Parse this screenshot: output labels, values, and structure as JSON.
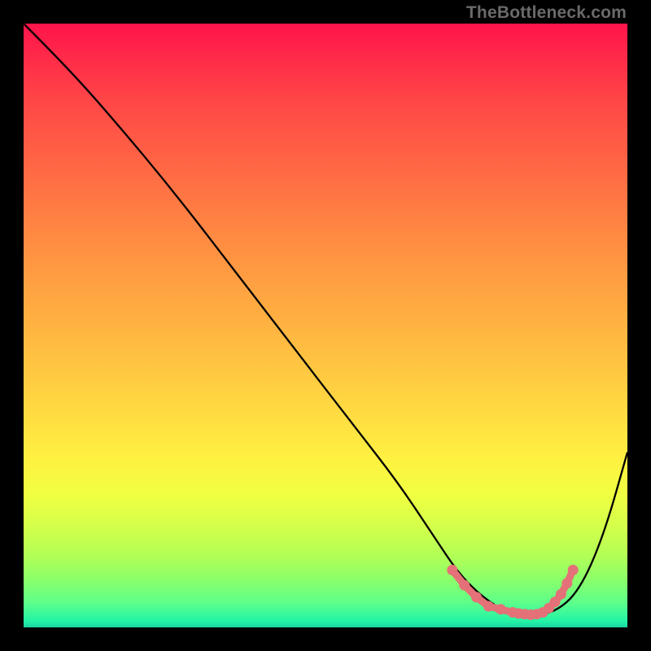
{
  "watermark": "TheBottleneck.com",
  "chart_data": {
    "type": "line",
    "title": "",
    "xlabel": "",
    "ylabel": "",
    "xlim": [
      0,
      100
    ],
    "ylim": [
      0,
      100
    ],
    "grid": false,
    "series": [
      {
        "name": "curve",
        "x": [
          0,
          7,
          15,
          25,
          35,
          45,
          55,
          62,
          68,
          72,
          76,
          80,
          84,
          88,
          92,
          96,
          100
        ],
        "y": [
          100,
          93,
          84,
          72,
          59,
          46,
          33,
          24,
          15,
          9,
          5,
          2.5,
          2,
          2.5,
          6,
          15,
          29
        ],
        "color": "#000000"
      },
      {
        "name": "optimal-zone",
        "x": [
          71,
          73,
          75,
          77,
          79,
          81,
          82,
          83,
          84,
          85,
          86,
          87,
          88,
          89,
          90,
          91
        ],
        "y": [
          9.5,
          7,
          5,
          3.5,
          3,
          2.5,
          2.3,
          2.2,
          2.1,
          2.2,
          2.5,
          3.2,
          4.2,
          5.5,
          7.3,
          9.5
        ],
        "color": "#e47178",
        "marker": true
      }
    ]
  },
  "colors": {
    "background": "#000000",
    "curve": "#000000",
    "markers": "#e47178"
  }
}
